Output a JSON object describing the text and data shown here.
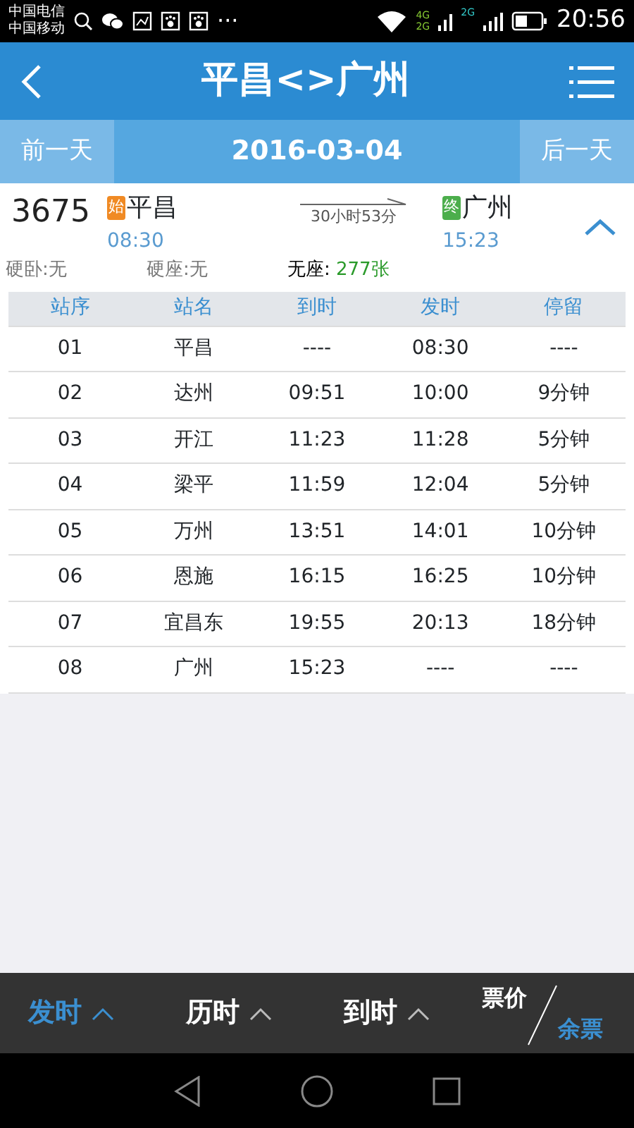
{
  "status_bar": {
    "carriers": [
      "中国电信",
      "中国移动"
    ],
    "more": "···",
    "network_labels": [
      "4G",
      "2G",
      "2G"
    ],
    "time": "20:56"
  },
  "header": {
    "title": "平昌<>广州"
  },
  "date_bar": {
    "prev": "前一天",
    "date": "2016-03-04",
    "next": "后一天"
  },
  "train": {
    "number": "3675",
    "from_tag": "始",
    "from": "平昌",
    "depart": "08:30",
    "duration": "30小时53分",
    "to_tag": "终",
    "to": "广州",
    "arrive": "15:23",
    "expanded": true,
    "seats": [
      {
        "label": "硬卧:无",
        "available": false
      },
      {
        "label": "硬座:无",
        "available": false
      },
      {
        "label": "无座",
        "separator": ":",
        "count": "277张",
        "available": true
      }
    ]
  },
  "table": {
    "columns": [
      "站序",
      "站名",
      "到时",
      "发时",
      "停留"
    ],
    "rows": [
      [
        "01",
        "平昌",
        "----",
        "08:30",
        "----"
      ],
      [
        "02",
        "达州",
        "09:51",
        "10:00",
        "9分钟"
      ],
      [
        "03",
        "开江",
        "11:23",
        "11:28",
        "5分钟"
      ],
      [
        "04",
        "梁平",
        "11:59",
        "12:04",
        "5分钟"
      ],
      [
        "05",
        "万州",
        "13:51",
        "14:01",
        "10分钟"
      ],
      [
        "06",
        "恩施",
        "16:15",
        "16:25",
        "10分钟"
      ],
      [
        "07",
        "宜昌东",
        "19:55",
        "20:13",
        "18分钟"
      ],
      [
        "08",
        "广州",
        "15:23",
        "----",
        "----"
      ]
    ]
  },
  "sort_bar": {
    "items": [
      {
        "label": "发时",
        "selected": true
      },
      {
        "label": "历时",
        "selected": false
      },
      {
        "label": "到时",
        "selected": false
      }
    ],
    "toggle": [
      {
        "label": "票价",
        "selected": false
      },
      {
        "label": "余票",
        "selected": true
      }
    ]
  }
}
